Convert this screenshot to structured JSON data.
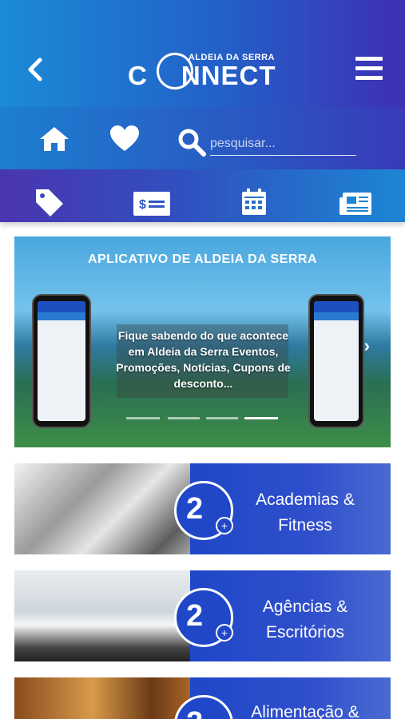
{
  "header": {
    "logo_top": "ALDEIA DA SERRA",
    "logo_main": "NNECT",
    "logo_prefix": "C"
  },
  "search": {
    "placeholder": "pesquisar..."
  },
  "icons": {
    "back": "chevron-left-icon",
    "menu": "hamburger-menu-icon",
    "home": "home-icon",
    "favorites": "heart-icon",
    "search": "search-icon",
    "coupons": "tag-icon",
    "prices": "money-bill-icon",
    "events": "calendar-icon",
    "news": "newspaper-icon"
  },
  "colors": {
    "header_start": "#1b8bd6",
    "header_end": "#3f2fb4",
    "card_blue": "#1f47c8"
  },
  "banner": {
    "title": "APLICATIVO DE ALDEIA DA SERRA",
    "text": "Fique sabendo do que acontece em Aldeia da Serra Eventos, Promoções, Notícias, Cupons de desconto...",
    "slides": 4,
    "active_slide": 4
  },
  "categories": [
    {
      "label_line1": "Academias &",
      "label_line2": "Fitness"
    },
    {
      "label_line1": "Agências &",
      "label_line2": "Escritórios"
    },
    {
      "label_line1": "Alimentação &",
      "label_line2": ""
    }
  ]
}
